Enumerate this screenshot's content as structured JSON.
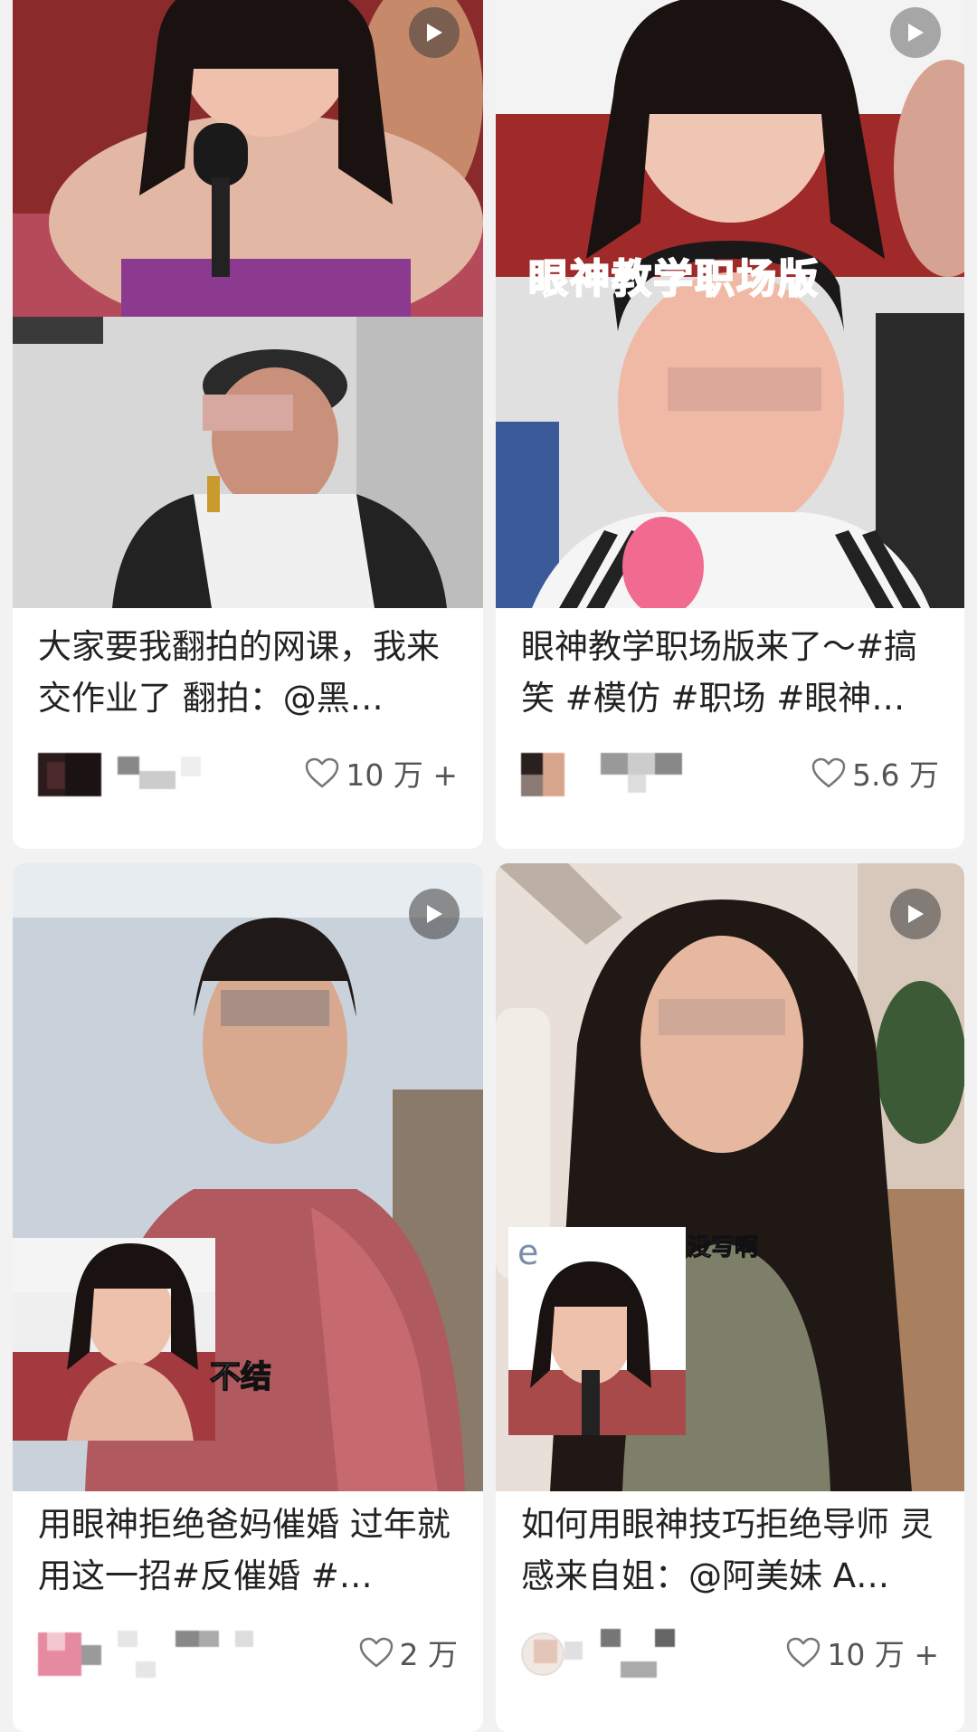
{
  "cards": [
    {
      "title": "大家要我翻拍的网课，我来交作业了 翻拍：@黑…",
      "likes": "10 万 +",
      "overlay_text": ""
    },
    {
      "title": "眼神教学职场版来了～#搞笑 #模仿 #职场 #眼神…",
      "likes": "5.6 万",
      "overlay_text": "眼神教学职场版"
    },
    {
      "title": "用眼神拒绝爸妈催婚 过年就用这一招#反催婚 #…",
      "likes": "2 万",
      "overlay_text": "不结"
    },
    {
      "title": "如何用眼神技巧拒绝导师 灵感来自姐：@阿美妹 A…",
      "likes": "10 万 +",
      "overlay_text": "没写啊",
      "overlay_letter": "e"
    }
  ],
  "icons": {
    "play": "play-icon",
    "like": "heart-outline-icon"
  },
  "colors": {
    "background": "#f2f2f2",
    "card": "#ffffff",
    "overlay_pink": "#ff5fa8"
  }
}
